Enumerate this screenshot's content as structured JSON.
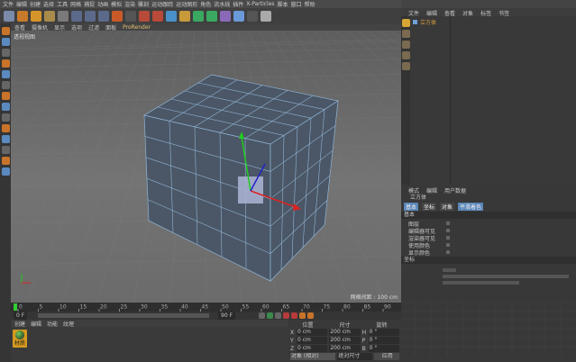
{
  "menu": [
    "文件",
    "编辑",
    "创建",
    "选择",
    "工具",
    "网格",
    "捕捉",
    "动画",
    "模拟",
    "渲染",
    "雕刻",
    "运动跟踪",
    "运动图形",
    "角色",
    "流水线",
    "插件",
    "X-Particles",
    "脚本",
    "窗口",
    "帮助"
  ],
  "viewport": {
    "menu": [
      "查看",
      "摄像机",
      "显示",
      "选项",
      "过滤",
      "面板",
      "ProRender"
    ],
    "label": "透视视图",
    "grid_info": "网格间距 : 100 cm"
  },
  "timeline": {
    "ticks": [
      "0",
      "5",
      "10",
      "15",
      "20",
      "25",
      "30",
      "35",
      "40",
      "45",
      "50",
      "55",
      "60",
      "65",
      "70",
      "75",
      "80",
      "85",
      "90"
    ],
    "end_frame": "0 F",
    "start_field": "0 F",
    "end_field": "90 F"
  },
  "materials": {
    "menu": [
      "创建",
      "编辑",
      "功能",
      "纹理"
    ],
    "item": "材质"
  },
  "coords": {
    "headers": [
      "位置",
      "尺寸",
      "旋转"
    ],
    "rows": [
      [
        "X",
        "0 cm",
        "200 cm",
        "H",
        "0 °"
      ],
      [
        "Y",
        "0 cm",
        "200 cm",
        "P",
        "0 °"
      ],
      [
        "Z",
        "0 cm",
        "200 cm",
        "B",
        "0 °"
      ]
    ],
    "mode": "对象 (相对)",
    "size_mode": "绝对尺寸",
    "apply": "应用"
  },
  "objects": {
    "menu": [
      "文件",
      "编辑",
      "查看",
      "对象",
      "标签",
      "书签"
    ],
    "item": "立方体"
  },
  "attributes": {
    "menu": [
      "模式",
      "编辑",
      "用户数据"
    ],
    "title": "立方体",
    "tabs": [
      "基本",
      "坐标",
      "对象",
      "平滑着色"
    ],
    "sections": [
      "基本",
      "坐标"
    ],
    "rows": [
      "图层",
      "编辑器可见",
      "渲染器可见",
      "使用颜色",
      "显示颜色"
    ]
  },
  "colors": {
    "accent": "#6fa0d8",
    "cube": "#4b5766",
    "wire": "#8fb4d6"
  }
}
